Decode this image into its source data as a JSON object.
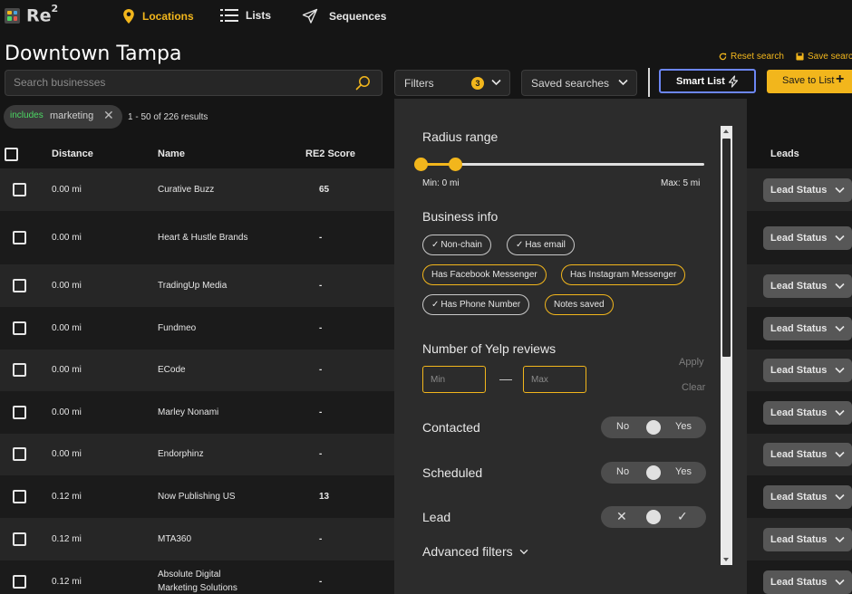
{
  "app": {
    "logo_text": "Re",
    "logo_sup": "2"
  },
  "nav": {
    "locations": "Locations",
    "lists": "Lists",
    "sequences": "Sequences"
  },
  "header": {
    "title": "Downtown Tampa",
    "reset_search": "Reset search",
    "save_search": "Save search"
  },
  "toolbar": {
    "search_placeholder": "Search businesses",
    "filters_label": "Filters",
    "filters_count": "3",
    "saved_searches_label": "Saved searches",
    "smart_list_label": "Smart List",
    "save_to_list_label": "Save to List",
    "save_to_list_icon": "+"
  },
  "filter_chip": {
    "prefix": "includes",
    "value": "marketing",
    "remove": "✕"
  },
  "results_text": "1 - 50 of 226 results",
  "table": {
    "columns": {
      "distance": "Distance",
      "name": "Name",
      "score": "RE2 Score",
      "leads": "Leads"
    },
    "lead_button_label": "Lead Status",
    "rows": [
      {
        "distance": "0.00 mi",
        "name": "Curative Buzz",
        "score": "65"
      },
      {
        "distance": "0.00 mi",
        "name": "Heart & Hustle Brands",
        "score": "-"
      },
      {
        "distance": "0.00 mi",
        "name": "TradingUp Media",
        "score": "-"
      },
      {
        "distance": "0.00 mi",
        "name": "Fundmeo",
        "score": "-"
      },
      {
        "distance": "0.00 mi",
        "name": "ECode",
        "score": "-"
      },
      {
        "distance": "0.00 mi",
        "name": "Marley Nonami",
        "score": "-"
      },
      {
        "distance": "0.00 mi",
        "name": "Endorphinz",
        "score": "-"
      },
      {
        "distance": "0.12 mi",
        "name": "Now Publishing US",
        "score": "13"
      },
      {
        "distance": "0.12 mi",
        "name": "MTA360",
        "score": "-"
      },
      {
        "distance": "0.12 mi",
        "name": "Absolute Digital Marketing Solutions",
        "name_line1": "Absolute Digital",
        "name_line2": "Marketing Solutions",
        "score": "-"
      }
    ]
  },
  "filter_panel": {
    "radius": {
      "title": "Radius range",
      "min_label": "Min: 0 mi",
      "max_label": "Max: 5 mi",
      "range_min": 0,
      "range_max": 5,
      "selected_min": 0,
      "selected_max": 0.6
    },
    "business_info": {
      "title": "Business info",
      "tags": [
        {
          "label": "Non-chain",
          "checked": true
        },
        {
          "label": "Has email",
          "checked": true
        },
        {
          "label": "Has Facebook Messenger",
          "checked": false
        },
        {
          "label": "Has Instagram Messenger",
          "checked": false
        },
        {
          "label": "Has Phone Number",
          "checked": true
        },
        {
          "label": "Notes saved",
          "checked": false
        }
      ]
    },
    "yelp": {
      "title": "Number of Yelp reviews",
      "min_placeholder": "Min",
      "max_placeholder": "Max",
      "separator": "—",
      "apply": "Apply",
      "clear": "Clear"
    },
    "contacted": {
      "title": "Contacted",
      "left": "No",
      "right": "Yes"
    },
    "scheduled": {
      "title": "Scheduled",
      "left": "No",
      "right": "Yes"
    },
    "lead": {
      "title": "Lead",
      "left": "✕",
      "right": "✓"
    },
    "advanced": "Advanced filters"
  },
  "colors": {
    "accent": "#f2b61c",
    "smart_list_border": "#6c86f4",
    "includes_green": "#4cd964",
    "background": "#151515"
  }
}
